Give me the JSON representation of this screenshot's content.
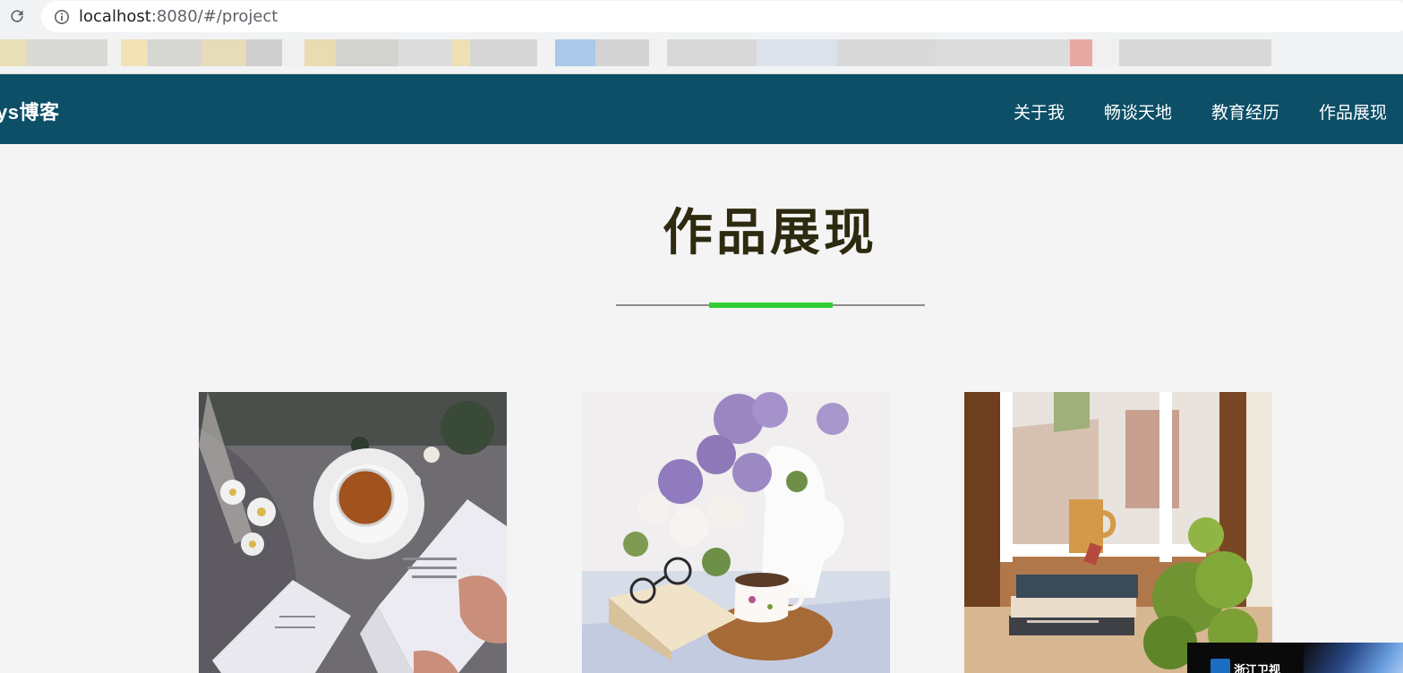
{
  "browser": {
    "url_host": "localhost",
    "url_path": ":8080/#/project"
  },
  "nav": {
    "brand": "ys博客",
    "links": [
      "关于我",
      "畅谈天地",
      "教育经历",
      "作品展现"
    ]
  },
  "main": {
    "title": "作品展现"
  },
  "overlay": {
    "text": "浙江卫视"
  },
  "colors": {
    "nav_bg": "#0d4f67",
    "accent_green": "#33cc33",
    "page_bg": "#f4f4f4",
    "title_color": "#2d2a0f"
  },
  "icons": [
    "reload-icon",
    "info-icon"
  ]
}
